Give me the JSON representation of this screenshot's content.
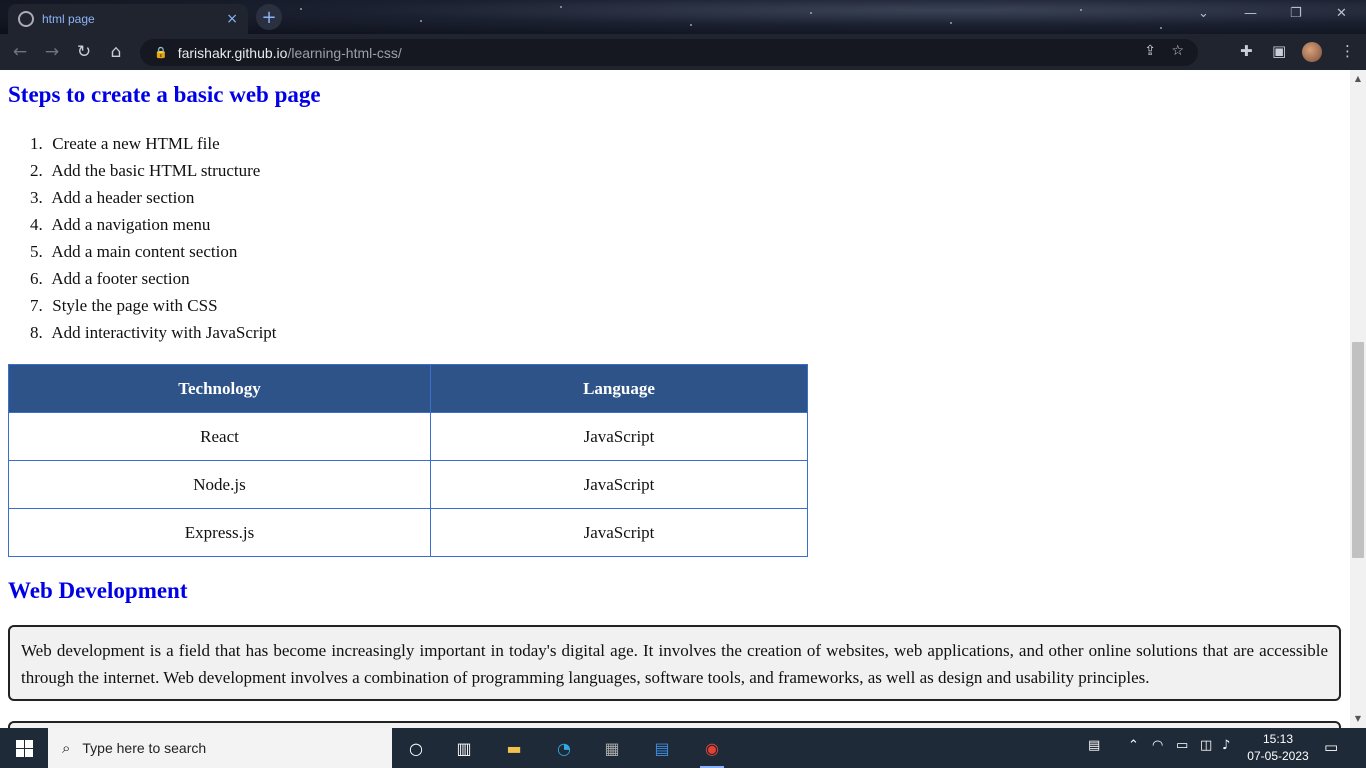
{
  "browser": {
    "tab": {
      "title": "html page",
      "close": "×"
    },
    "new_tab": "+",
    "window_controls": {
      "dropdown": "⌄",
      "minimize": "—",
      "restore": "❐",
      "close": "✕"
    },
    "nav": {
      "back": "←",
      "forward": "→",
      "reload": "↻",
      "home": "⌂"
    },
    "address": {
      "lock": "🔒",
      "host": "farishakr.github.io",
      "path": "/learning-html-css/"
    },
    "icons": {
      "share": "⇪",
      "bookmark": "☆",
      "extensions": "✚",
      "sidepanel": "▣",
      "menu": "⋮"
    }
  },
  "page": {
    "steps_heading": "Steps to create a basic web page",
    "steps": [
      {
        "num": "1.",
        "text": "Create a new HTML file"
      },
      {
        "num": "2.",
        "text": "Add the basic HTML structure"
      },
      {
        "num": "3.",
        "text": "Add a header section"
      },
      {
        "num": "4.",
        "text": "Add a navigation menu"
      },
      {
        "num": "5.",
        "text": "Add a main content section"
      },
      {
        "num": "6.",
        "text": "Add a footer section"
      },
      {
        "num": "7.",
        "text": "Style the page with CSS"
      },
      {
        "num": "8.",
        "text": "Add interactivity with JavaScript"
      }
    ],
    "table": {
      "headers": [
        "Technology",
        "Language"
      ],
      "rows": [
        [
          "React",
          "JavaScript"
        ],
        [
          "Node.js",
          "JavaScript"
        ],
        [
          "Express.js",
          "JavaScript"
        ]
      ]
    },
    "webdev_heading": "Web Development",
    "webdev_text": "Web development is a field that has become increasingly important in today's digital age. It involves the creation of websites, web applications, and other online solutions that are accessible through the internet. Web development involves a combination of programming languages, software tools, and frameworks, as well as design and usability principles."
  },
  "taskbar": {
    "search_placeholder": "Type here to search",
    "clock": {
      "time": "15:13",
      "date": "07-05-2023"
    }
  },
  "colors": {
    "heading": "#0000e6",
    "table_header_bg": "#2e5388",
    "table_border": "#3a6fd0",
    "info_box_bg": "#f1f1f1"
  }
}
